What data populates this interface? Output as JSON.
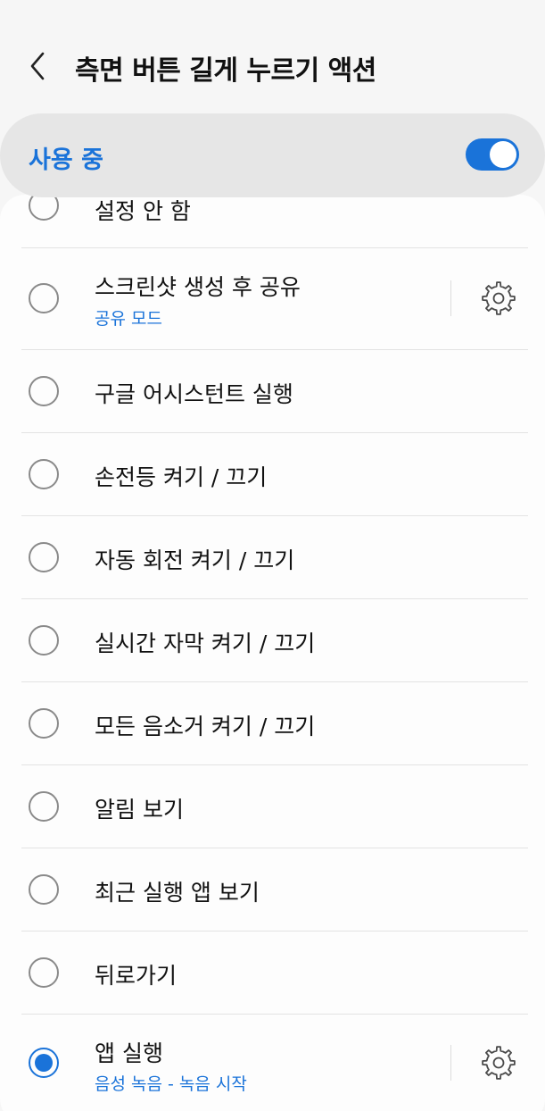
{
  "header": {
    "title": "측면 버튼 길게 누르기 액션"
  },
  "master": {
    "label": "사용 중",
    "enabled": true
  },
  "options": [
    {
      "label": "설정 안 함",
      "selected": false
    },
    {
      "label": "스크린샷 생성 후 공유",
      "sub": "공유 모드",
      "selected": false,
      "has_settings": true
    },
    {
      "label": "구글 어시스턴트 실행",
      "selected": false
    },
    {
      "label": "손전등 켜기 / 끄기",
      "selected": false
    },
    {
      "label": "자동 회전 켜기 / 끄기",
      "selected": false
    },
    {
      "label": "실시간 자막 켜기 / 끄기",
      "selected": false
    },
    {
      "label": "모든 음소거 켜기 / 끄기",
      "selected": false
    },
    {
      "label": "알림 보기",
      "selected": false
    },
    {
      "label": "최근 실행 앱 보기",
      "selected": false
    },
    {
      "label": "뒤로가기",
      "selected": false
    },
    {
      "label": "앱 실행",
      "sub": "음성 녹음 - 녹음 시작",
      "selected": true,
      "has_settings": true
    }
  ],
  "colors": {
    "accent": "#1a73d9",
    "background": "#f6f6f6",
    "card": "#fdfdfd",
    "master_bar": "#e6e6e6"
  },
  "icons": {
    "back": "chevron-left-icon",
    "settings": "gear-icon"
  }
}
